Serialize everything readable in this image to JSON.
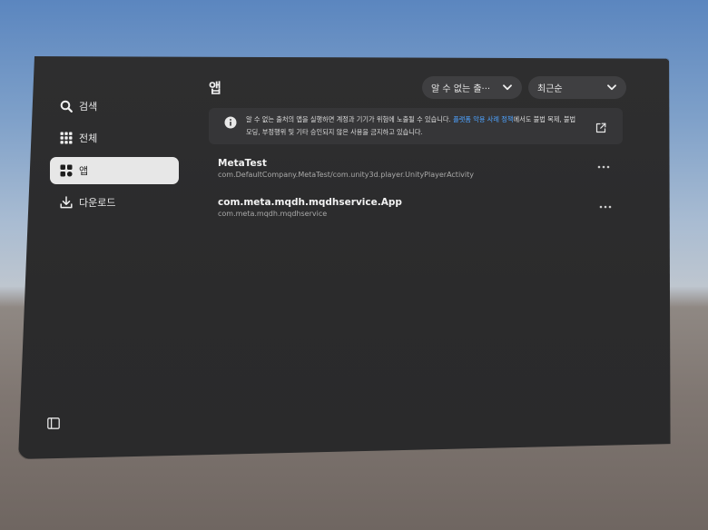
{
  "sidebar": {
    "items": [
      {
        "label": "검색",
        "icon": "search-icon"
      },
      {
        "label": "전체",
        "icon": "grid-icon"
      },
      {
        "label": "앱",
        "icon": "apps-icon",
        "active": true
      },
      {
        "label": "다운로드",
        "icon": "download-icon"
      }
    ],
    "toggle_icon": "sidebar-toggle-icon"
  },
  "header": {
    "title": "앱",
    "filter_dropdown": "알 수 없는 출···",
    "sort_dropdown": "최근순"
  },
  "banner": {
    "text_before": "알 수 없는 출처의 앱을 실행하면 계정과 기기가 위험에 노출될 수 있습니다. ",
    "link_text": "플랫폼 악용 사례 정책",
    "text_after": "에서도 불법 복제, 불법 모딩, 부정행위 및 기타 승인되지 않은 사용을 금지하고 있습니다.",
    "info_icon": "info-icon",
    "external_icon": "external-link-icon"
  },
  "apps": [
    {
      "name": "MetaTest",
      "package": "com.DefaultCompany.MetaTest/com.unity3d.player.UnityPlayerActivity"
    },
    {
      "name": "com.meta.mqdh.mqdhservice.App",
      "package": "com.meta.mqdh.mqdhservice"
    }
  ],
  "colors": {
    "panel_bg": "#2d2d2e",
    "active_nav_bg": "#e7e7e7",
    "link": "#4ea3ff"
  }
}
